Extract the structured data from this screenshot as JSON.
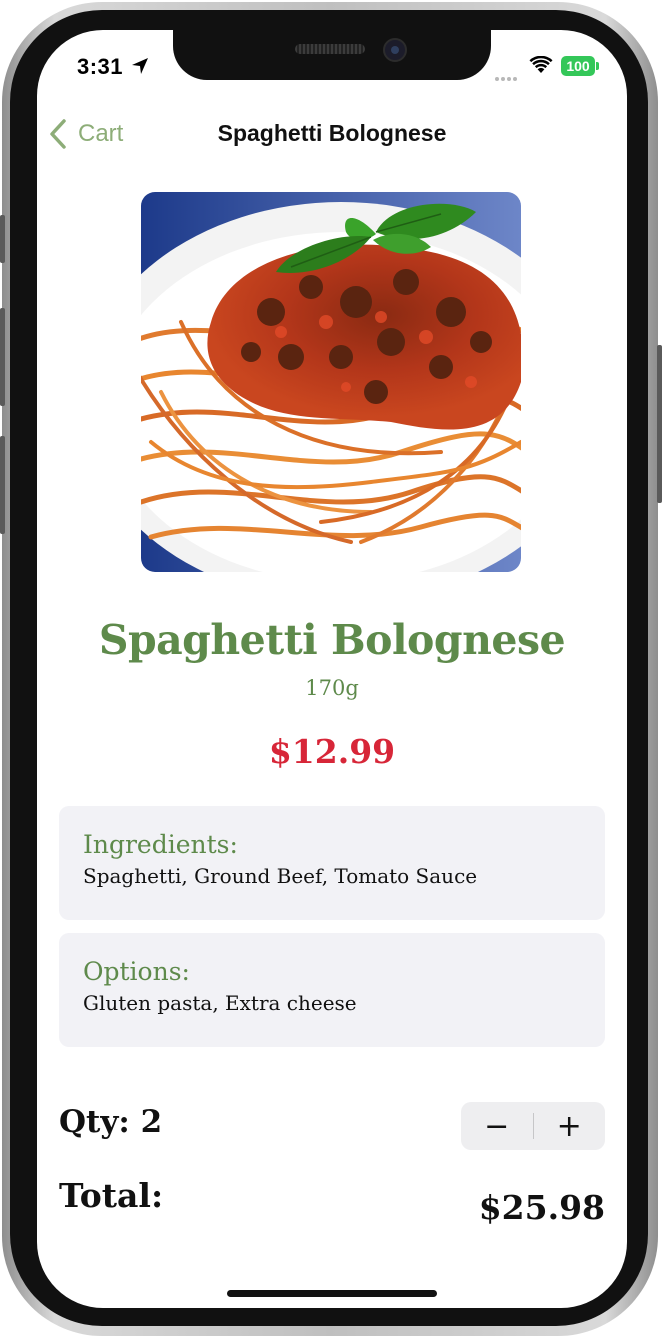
{
  "status_bar": {
    "time": "3:31",
    "battery": "100"
  },
  "nav": {
    "back_label": "Cart",
    "title": "Spaghetti Bolognese"
  },
  "dish": {
    "name": "Spaghetti Bolognese",
    "weight": "170g",
    "price": "$12.99"
  },
  "ingredients": {
    "heading": "Ingredients:",
    "text": "Spaghetti, Ground Beef, Tomato Sauce"
  },
  "options": {
    "heading": "Options:",
    "text": "Gluten pasta, Extra cheese"
  },
  "order": {
    "qty_label": "Qty: 2",
    "minus": "−",
    "plus": "+",
    "total_label": "Total:",
    "total_value": "$25.98"
  },
  "colors": {
    "accent_green": "#5e8a4b",
    "back_green": "#8dad78",
    "price_red": "#d72638",
    "battery_green": "#34c759",
    "card_bg": "#f2f2f6"
  },
  "icons": [
    "location-arrow-icon",
    "wifi-icon",
    "battery-icon",
    "chevron-left-icon",
    "minus-icon",
    "plus-icon"
  ]
}
